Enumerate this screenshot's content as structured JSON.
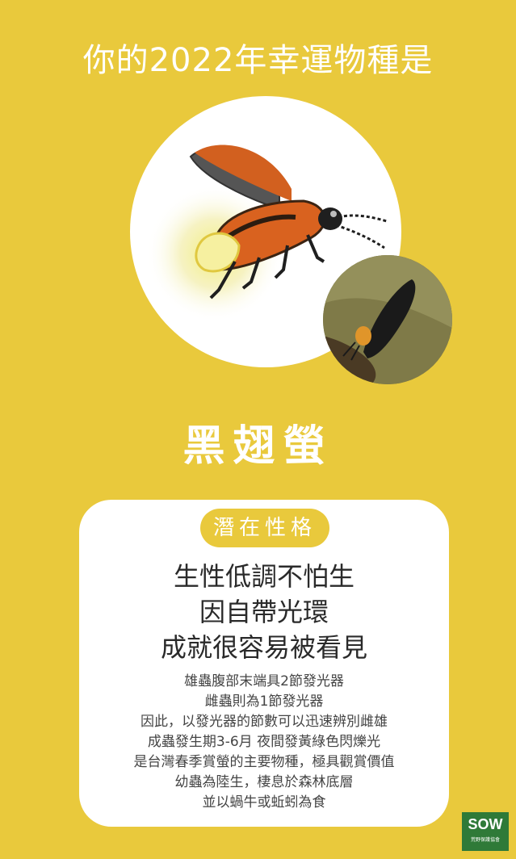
{
  "title": "你的2022年幸運物種是",
  "species_name": "黑翅螢",
  "badge": "潛在性格",
  "personality_lines": [
    "生性低調不怕生",
    "因自帶光環",
    "成就很容易被看見"
  ],
  "description_lines": [
    "雄蟲腹部末端具2節發光器",
    "雌蟲則為1節發光器",
    "因此，以發光器的節數可以迅速辨別雌雄",
    "成蟲發生期3-6月 夜間發黃綠色閃爍光",
    "是台灣春季賞螢的主要物種，極具觀賞價值",
    "幼蟲為陸生，棲息於森林底層",
    "並以蝸牛或蚯蚓為食"
  ],
  "logo": {
    "main": "SOW",
    "sub": "荒野保護協會"
  },
  "colors": {
    "background": "#e9c93c",
    "card": "#ffffff",
    "logo": "#2f7a38"
  }
}
